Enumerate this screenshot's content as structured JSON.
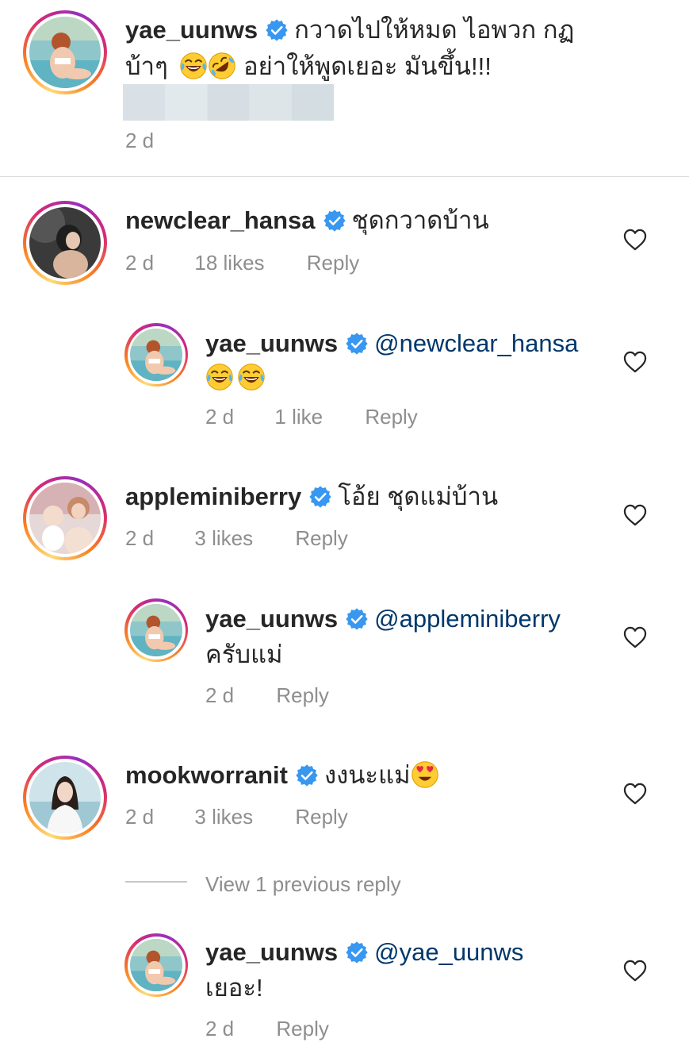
{
  "main_comment": {
    "username": "yae_uunws",
    "text_line1": "กวาดไปให้หมด ไอพวก กฏ",
    "text_line2_prefix": "บ้าๆ",
    "text_line2_suffix": "อย่าให้พูดเยอะ มันขึ้น!!!",
    "time": "2 d"
  },
  "comments": [
    {
      "username": "newclear_hansa",
      "text": "ชุดกวาดบ้าน",
      "time": "2 d",
      "likes": "18 likes",
      "reply_label": "Reply",
      "replies": [
        {
          "username": "yae_uunws",
          "mention": "@newclear_hansa",
          "time": "2 d",
          "likes": "1 like",
          "reply_label": "Reply"
        }
      ]
    },
    {
      "username": "appleminiberry",
      "text": "โอ้ย ชุดแม่บ้าน",
      "time": "2 d",
      "likes": "3 likes",
      "reply_label": "Reply",
      "replies": [
        {
          "username": "yae_uunws",
          "mention": "@appleminiberry",
          "text": "ครับแม่",
          "time": "2 d",
          "reply_label": "Reply"
        }
      ]
    },
    {
      "username": "mookworranit",
      "text": "งงนะแม่",
      "time": "2 d",
      "likes": "3 likes",
      "reply_label": "Reply",
      "view_previous": "View 1 previous reply",
      "replies": [
        {
          "username": "yae_uunws",
          "mention": "@yae_uunws",
          "text": "เยอะ!",
          "time": "2 d",
          "reply_label": "Reply"
        }
      ]
    }
  ],
  "icons": {
    "verified": "verified-badge-icon",
    "heart": "heart-outline-icon",
    "laugh": "face-with-tears-of-joy-emoji",
    "rofl": "rolling-on-floor-laughing-emoji",
    "heart_eyes": "heart-eyes-emoji"
  },
  "colors": {
    "verified_blue": "#3897f0",
    "mention_blue": "#00376b",
    "meta_gray": "#8e8e8e",
    "text": "#262626"
  }
}
